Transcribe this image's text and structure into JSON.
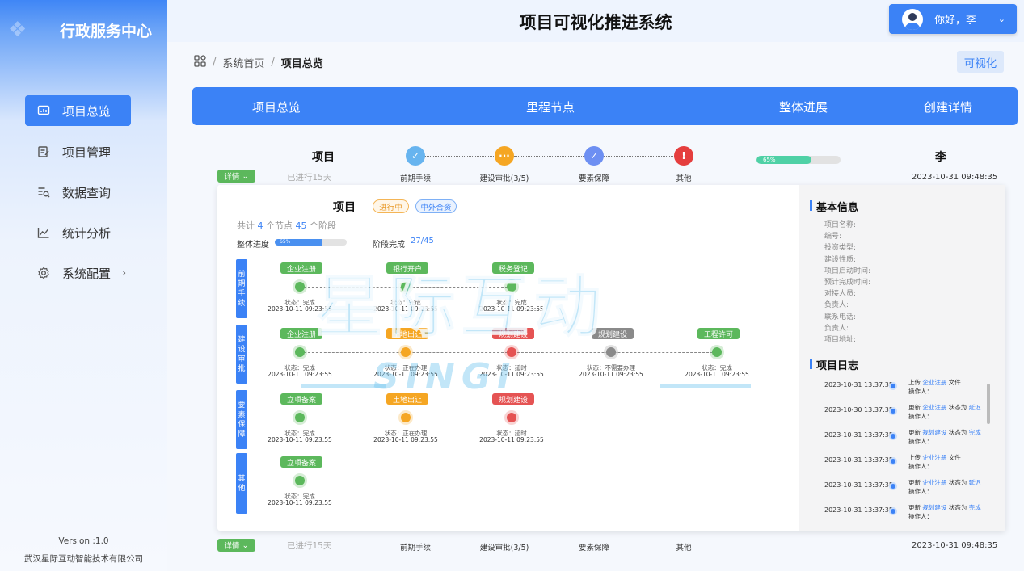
{
  "brand": {
    "title": "行政服务中心"
  },
  "sidebar": {
    "items": [
      {
        "label": "项目总览",
        "icon": "dashboard-icon"
      },
      {
        "label": "项目管理",
        "icon": "edit-doc-icon"
      },
      {
        "label": "数据查询",
        "icon": "search-list-icon"
      },
      {
        "label": "统计分析",
        "icon": "line-chart-icon"
      },
      {
        "label": "系统配置",
        "icon": "gear-icon"
      }
    ],
    "version": "Version :1.0",
    "company": "武汉星际互动智能技术有限公司"
  },
  "header": {
    "title": "项目可视化推进系统",
    "greeting": "你好，李"
  },
  "breadcrumb": {
    "home": "系统首页",
    "current": "项目总览"
  },
  "viz_button": "可视化",
  "tabs": [
    "项目总览",
    "里程节点",
    "整体进展",
    "创建详情"
  ],
  "rows": [
    {
      "title": "项目",
      "sub": "已进行15天",
      "detail": "详情",
      "steps": [
        "前期手续",
        "建设审批(3/5)",
        "要素保障",
        "其他"
      ],
      "progress": 0.65,
      "progress_label": "65%",
      "owner": "李",
      "time": "2023-10-31  09:48:35"
    },
    {
      "title": "",
      "sub": "已进行15天",
      "detail": "详情",
      "steps": [
        "前期手续",
        "建设审批(3/5)",
        "要素保障",
        "其他"
      ],
      "owner": "",
      "time": "2023-10-31  09:48:35"
    }
  ],
  "panel": {
    "title": "项目",
    "badges": [
      "进行中",
      "中外合资"
    ],
    "counts": {
      "prefix": "共计",
      "nodes": "4",
      "nodes_unit": "个节点",
      "stages": "45",
      "stages_unit": "个阶段"
    },
    "progress_label": "整体进度",
    "progress": 0.65,
    "progress_text": "65%",
    "stage_label": "阶段完成",
    "stage_value": "27/45",
    "stages": [
      {
        "name": "前期手续",
        "nodes": [
          {
            "tag": "企业注册",
            "color": "#5cb85c",
            "status": "状态：完成",
            "time": "2023-10-11 09:23:55"
          },
          {
            "tag": "银行开户",
            "color": "#5cb85c",
            "status": "状态：完成",
            "time": "2023-10-11 09:23:55"
          },
          {
            "tag": "税务登记",
            "color": "#5cb85c",
            "status": "状态：完成",
            "time": "2023-10-11 09:23:55"
          }
        ]
      },
      {
        "name": "建设审批",
        "nodes": [
          {
            "tag": "企业注册",
            "color": "#5cb85c",
            "status": "状态：完成",
            "time": "2023-10-11 09:23:55"
          },
          {
            "tag": "土地出让",
            "color": "#f5a623",
            "status": "状态：正在办理",
            "time": "2023-10-11 09:23:55"
          },
          {
            "tag": "规划建设",
            "color": "#e55353",
            "status": "状态：延时",
            "time": "2023-10-11 09:23:55"
          },
          {
            "tag": "规划建设",
            "color": "#8a8a8a",
            "status": "状态：不需要办理",
            "time": "2023-10-11 09:23:55"
          },
          {
            "tag": "工程许可",
            "color": "#5cb85c",
            "status": "状态：完成",
            "time": "2023-10-11 09:23:55"
          }
        ]
      },
      {
        "name": "要素保障",
        "nodes": [
          {
            "tag": "立项备案",
            "color": "#5cb85c",
            "status": "状态：完成",
            "time": "2023-10-11 09:23:55"
          },
          {
            "tag": "土地出让",
            "color": "#f5a623",
            "status": "状态：正在办理",
            "time": "2023-10-11 09:23:55"
          },
          {
            "tag": "规划建设",
            "color": "#e55353",
            "status": "状态：延时",
            "time": "2023-10-11 09:23:55"
          }
        ]
      },
      {
        "name": "其他",
        "nodes": [
          {
            "tag": "立项备案",
            "color": "#5cb85c",
            "status": "状态：完成",
            "time": "2023-10-11 09:23:55"
          }
        ]
      }
    ]
  },
  "info": {
    "title": "基本信息",
    "fields": [
      "项目名称:",
      "编号:",
      "投资类型:",
      "建设性质:",
      "项目启动时间:",
      "预计完成时间:",
      "对接人员:",
      "负责人:",
      "联系电话:",
      "负责人:",
      "项目地址:"
    ]
  },
  "log": {
    "title": "项目日志",
    "entries": [
      {
        "time": "2023-10-31 13:37:35",
        "verb": "上传",
        "target": "企业注册",
        "tail": "文件",
        "op": "操作人："
      },
      {
        "time": "2023-10-30 13:37:35",
        "verb": "更新",
        "target": "企业注册",
        "mid": "状态为",
        "state": "延迟",
        "op": "操作人："
      },
      {
        "time": "2023-10-31 13:37:35",
        "verb": "更新",
        "target": "规划建设",
        "mid": "状态为",
        "state": "完成",
        "op": "操作人："
      },
      {
        "time": "2023-10-31 13:37:35",
        "verb": "上传",
        "target": "企业注册",
        "tail": "文件",
        "op": "操作人："
      },
      {
        "time": "2023-10-31 13:37:35",
        "verb": "更新",
        "target": "企业注册",
        "mid": "状态为",
        "state": "延迟",
        "op": "操作人："
      },
      {
        "time": "2023-10-31 13:37:35",
        "verb": "更新",
        "target": "规划建设",
        "mid": "状态为",
        "state": "完成",
        "op": "操作人："
      }
    ]
  },
  "watermark": {
    "cn": "星际互动",
    "en": "SINGI"
  },
  "colors": {
    "primary": "#3b82f6",
    "done": "#5cb85c",
    "doing": "#f5a623",
    "late": "#e55353",
    "skip": "#8a8a8a"
  }
}
